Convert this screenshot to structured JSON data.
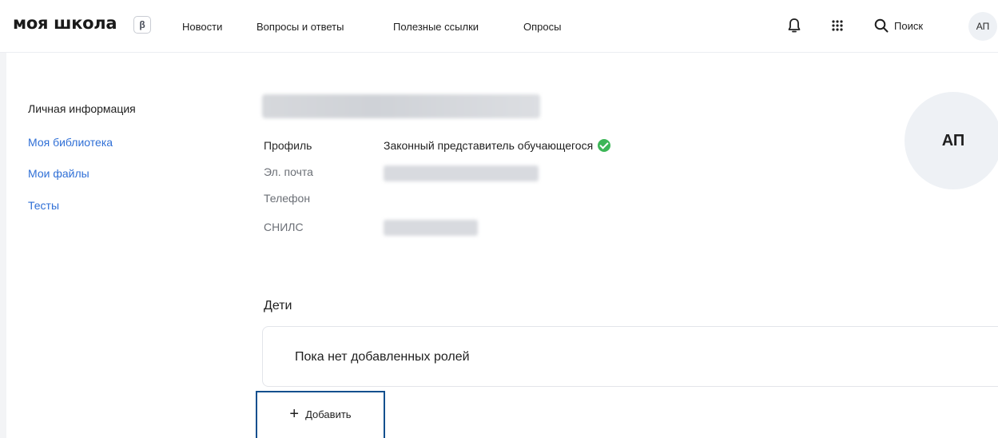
{
  "header": {
    "logo": "моя школа",
    "beta": "β",
    "nav": [
      "Новости",
      "Вопросы и ответы",
      "Полезные ссылки",
      "Опросы"
    ],
    "search_label": "Поиск",
    "avatar_initials": "АП"
  },
  "sidebar": {
    "items": [
      {
        "label": "Личная информация"
      },
      {
        "label": "Моя библиотека"
      },
      {
        "label": "Мои файлы"
      },
      {
        "label": "Тесты"
      }
    ]
  },
  "profile": {
    "fields": [
      {
        "label": "Профиль",
        "value": "Законный представитель обучающегося"
      },
      {
        "label": "Эл. почта",
        "value": ""
      },
      {
        "label": "Телефон",
        "value": ""
      },
      {
        "label": "СНИЛС",
        "value": ""
      }
    ],
    "avatar_initials": "АП",
    "verified_color": "#3cb657"
  },
  "children": {
    "title": "Дети",
    "empty_text": "Пока нет добавленных ролей",
    "add_button": "Добавить"
  }
}
